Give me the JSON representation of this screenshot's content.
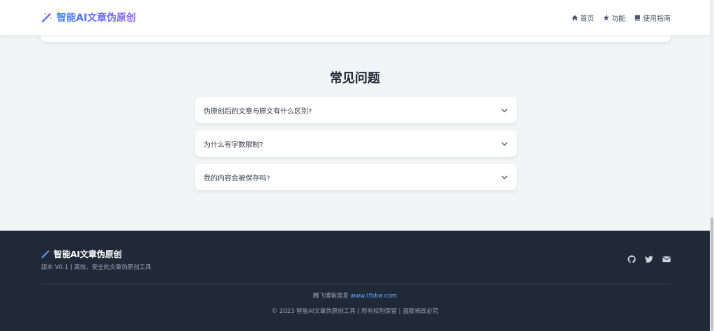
{
  "header": {
    "brand": "智能AI文章伪原创",
    "brand_icon": "magic-wand-icon",
    "nav": [
      {
        "label": "首页",
        "icon": "home-icon"
      },
      {
        "label": "功能",
        "icon": "star-icon"
      },
      {
        "label": "使用指南",
        "icon": "book-icon"
      }
    ]
  },
  "faq": {
    "title": "常见问题",
    "items": [
      {
        "question": "伪原创后的文章与原文有什么区别?"
      },
      {
        "question": "为什么有字数限制?"
      },
      {
        "question": "我的内容会被保存吗?"
      }
    ]
  },
  "footer": {
    "brand": "智能AI文章伪原创",
    "version": "版本 V0.1 | 高效、安全的文章伪原创工具",
    "social": [
      "github-icon",
      "twitter-icon",
      "envelope-icon"
    ],
    "credit_prefix": "腾飞博客首发",
    "credit_link": "www.tfbkw.com",
    "copyright": "© 2023 智能AI文章伪原创工具 | 所有权利保留 | 盗版修改必究"
  },
  "colors": {
    "brand_gradient_start": "#3b82f6",
    "brand_gradient_end": "#8b5cf6",
    "footer_bg": "#1f2937",
    "page_bg": "#f3f4f6",
    "link": "#60a5fa"
  }
}
